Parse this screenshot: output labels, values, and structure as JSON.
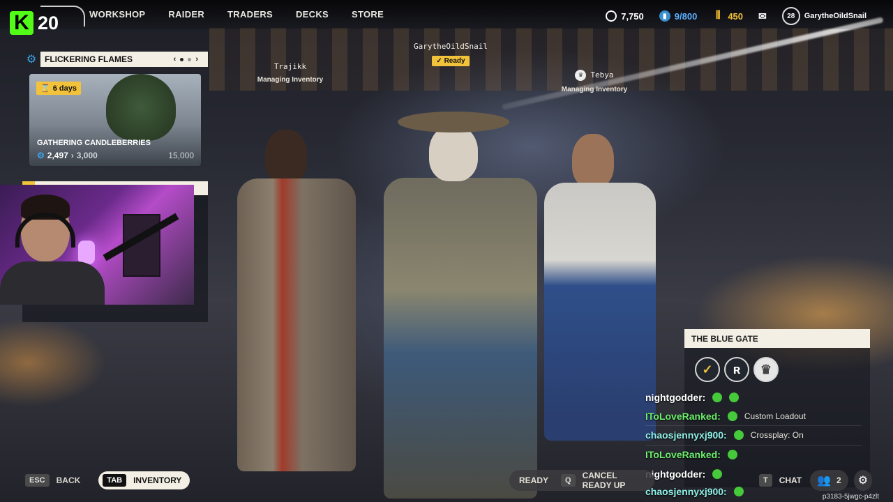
{
  "branding": {
    "platform_logo_letter": "K",
    "channel_number": "20"
  },
  "nav": {
    "items": [
      "WORKSHOP",
      "RAIDER",
      "TRADERS",
      "DECKS",
      "STORE"
    ]
  },
  "currencies": {
    "credits": "7,750",
    "capacity": "9/800",
    "tokens": "450",
    "level": "28",
    "username": "GarytheOildSnail"
  },
  "event": {
    "title": "FLICKERING FLAMES",
    "timer": "6  days",
    "name": "GATHERING CANDLEBERRIES",
    "progress_current": "2,497",
    "progress_mid": "3,000",
    "progress_max": "15,000"
  },
  "players": {
    "left": {
      "name": "Trajikk",
      "status": "Managing Inventory"
    },
    "center": {
      "name": "GarytheOildSnail",
      "status": "Ready"
    },
    "right": {
      "name": "Tebya",
      "status": "Managing Inventory"
    }
  },
  "gate": {
    "title": "THE BLUE GATE"
  },
  "chat": [
    {
      "user": "nightgodder:",
      "message": "",
      "color": "white"
    },
    {
      "user": "IToLoveRanked:",
      "message": "Custom Loadout",
      "color": "green"
    },
    {
      "user": "chaosjennyxj900:",
      "message": "Crossplay: On",
      "color": "cyan"
    },
    {
      "user": "IToLoveRanked:",
      "message": "",
      "color": "green"
    },
    {
      "user": "nightgodder:",
      "message": "",
      "color": "white"
    },
    {
      "user": "chaosjennyxj900:",
      "message": "",
      "color": "cyan"
    }
  ],
  "bottom": {
    "esc_key": "ESC",
    "back_label": "BACK",
    "tab_key": "TAB",
    "inventory_label": "INVENTORY",
    "ready_label": "READY",
    "cancel_key": "Q",
    "cancel_label": "CANCEL READY UP",
    "chat_key": "T",
    "chat_label": "CHAT",
    "party_count": "2",
    "session_code": "p3183-5jwgc-p4zlt"
  },
  "colors": {
    "accent_yellow": "#f2c23a",
    "kick_green": "#53fc18",
    "blue_currency": "#5ab0ff"
  }
}
